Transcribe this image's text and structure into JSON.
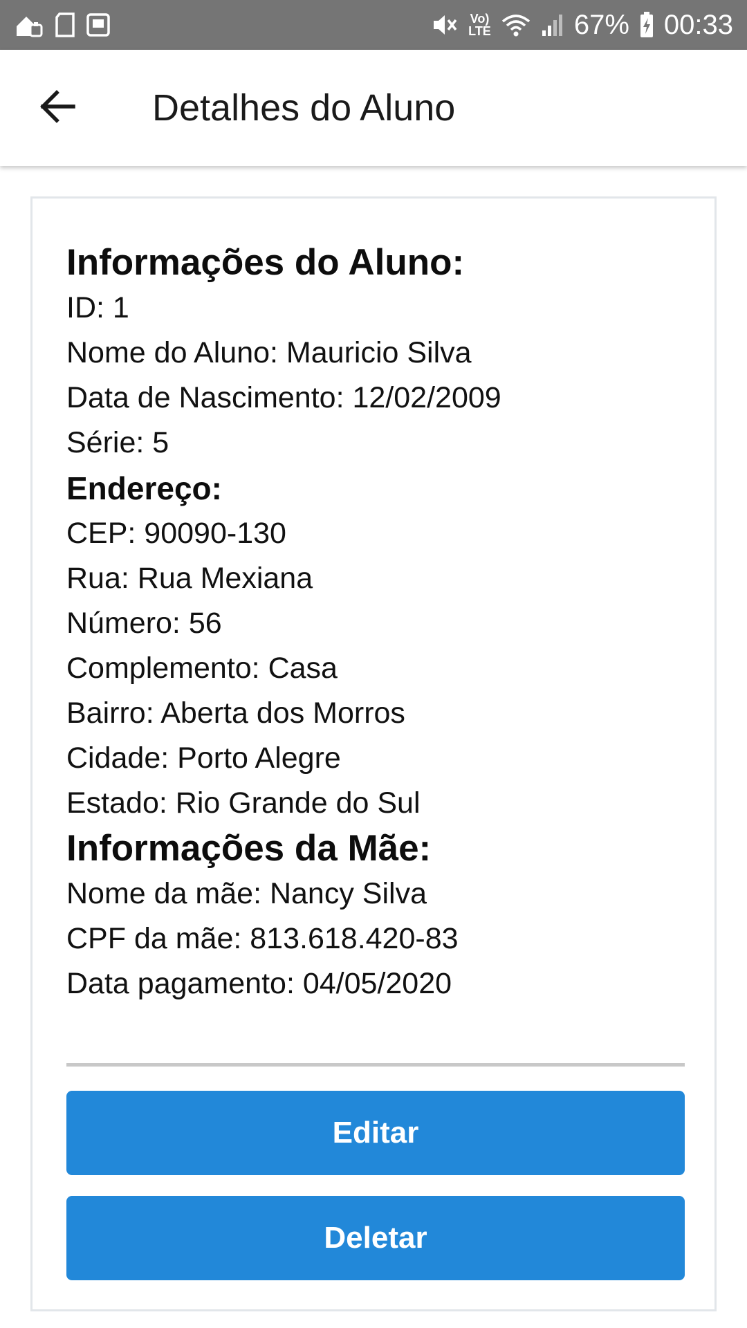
{
  "status_bar": {
    "signal_label_top": "Vo)",
    "signal_label_bottom": "LTE",
    "battery_percent": "67%",
    "time": "00:33"
  },
  "app_bar": {
    "title": "Detalhes do Aluno"
  },
  "student": {
    "heading": "Informações do Aluno:",
    "id": "ID: 1",
    "name": "Nome do Aluno: Mauricio Silva",
    "birth_date": "Data de Nascimento: 12/02/2009",
    "grade": "Série: 5"
  },
  "address": {
    "heading": "Endereço:",
    "cep": "CEP: 90090-130",
    "street": "Rua: Rua Mexiana",
    "number": "Número: 56",
    "complement": "Complemento: Casa",
    "neighborhood": "Bairro: Aberta dos Morros",
    "city": "Cidade: Porto Alegre",
    "state": "Estado: Rio Grande do Sul"
  },
  "mother": {
    "heading": "Informações da Mãe:",
    "name": "Nome da mãe: Nancy Silva",
    "cpf": "CPF da mãe: 813.618.420-83",
    "payment_date": "Data pagamento: 04/05/2020"
  },
  "actions": {
    "edit_label": "Editar",
    "delete_label": "Deletar"
  },
  "colors": {
    "status_bar": "#757575",
    "button": "#2288d9",
    "card_border": "#e2e6ea"
  }
}
